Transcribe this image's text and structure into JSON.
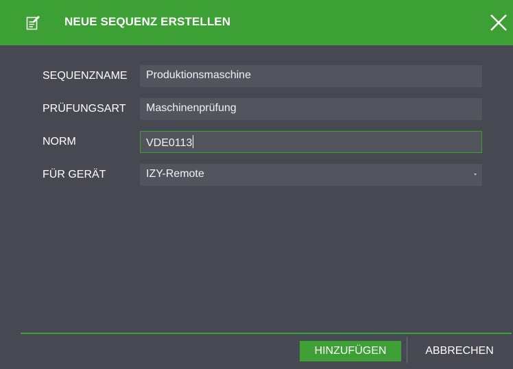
{
  "dialog": {
    "title": "NEUE SEQUENZ ERSTELLEN",
    "title_icon": "edit-document-icon",
    "close_icon": "close-icon"
  },
  "form": {
    "fields": [
      {
        "label": "SEQUENZNAME",
        "value": "Produktionsmaschine"
      },
      {
        "label": "PRÜFUNGSART",
        "value": "Maschinenprüfung"
      },
      {
        "label": "NORM",
        "value": "VDE0113"
      },
      {
        "label": "FÜR GERÄT",
        "value": "IZY-Remote"
      }
    ]
  },
  "footer": {
    "add_label": "HINZUFÜGEN",
    "cancel_label": "ABBRECHEN"
  },
  "colors": {
    "accent": "#3ca034",
    "background": "#464951",
    "field": "#52555d"
  }
}
